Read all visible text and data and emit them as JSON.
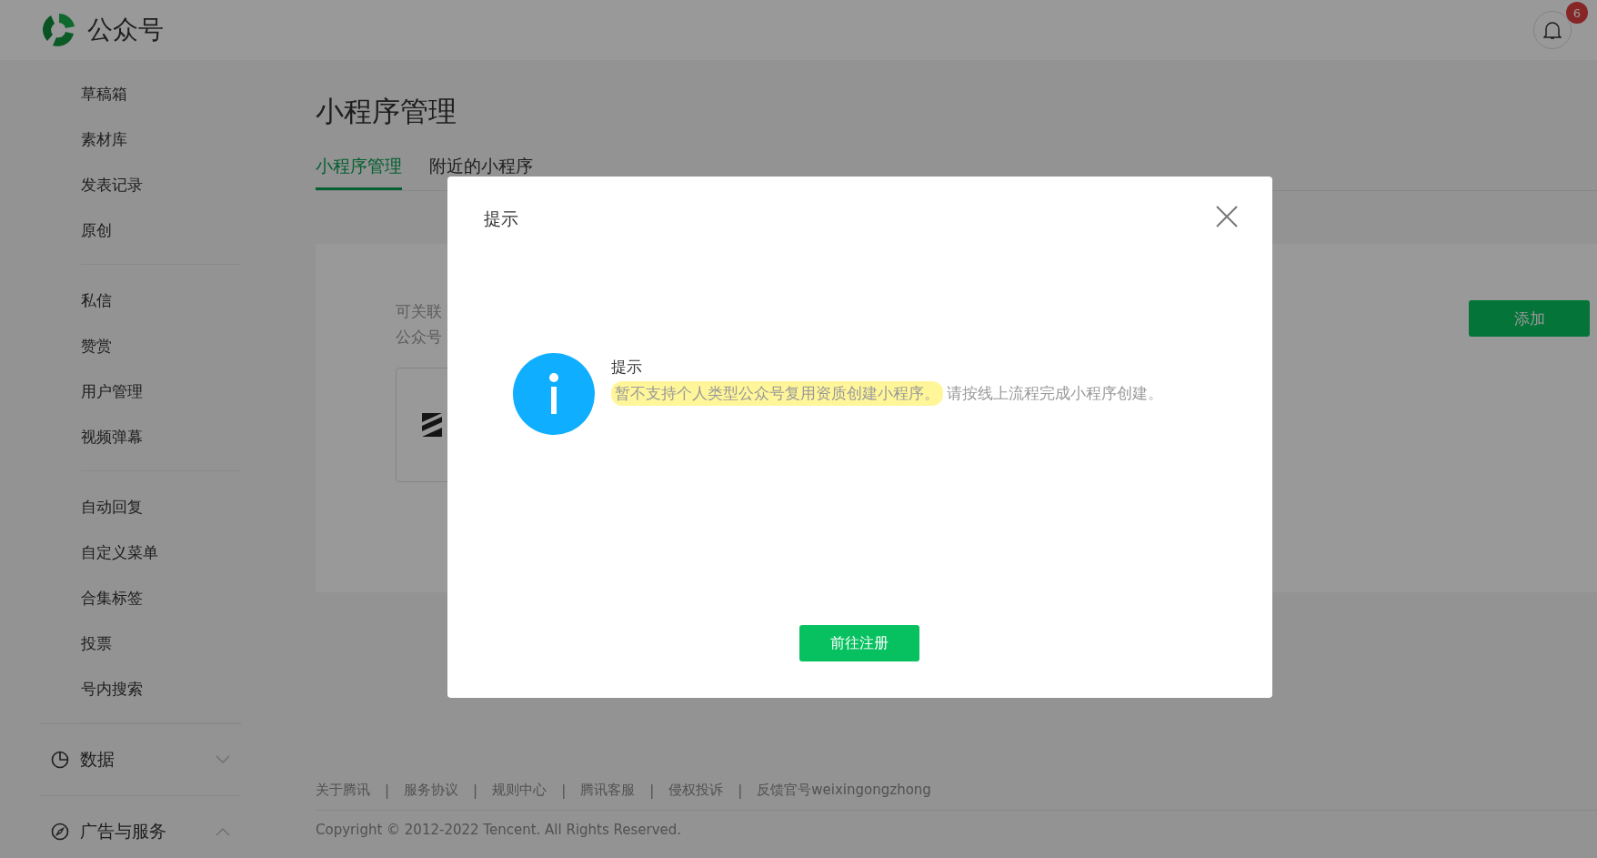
{
  "header": {
    "brand": "公众号",
    "notifications": "6"
  },
  "sidebar": {
    "groups": [
      {
        "items": [
          {
            "label": "草稿箱"
          },
          {
            "label": "素材库"
          },
          {
            "label": "发表记录"
          },
          {
            "label": "原创"
          }
        ]
      },
      {
        "items": [
          {
            "label": "私信"
          },
          {
            "label": "赞赏"
          },
          {
            "label": "用户管理"
          },
          {
            "label": "视频弹幕"
          }
        ]
      },
      {
        "items": [
          {
            "label": "自动回复"
          },
          {
            "label": "自定义菜单"
          },
          {
            "label": "合集标签"
          },
          {
            "label": "投票"
          },
          {
            "label": "号内搜索"
          }
        ]
      }
    ],
    "sections": [
      {
        "label": "数据",
        "kind": "chart",
        "expanded": false
      },
      {
        "label": "广告与服务",
        "kind": "compass",
        "expanded": true
      }
    ]
  },
  "page": {
    "title": "小程序管理",
    "tabs": [
      {
        "label": "小程序管理",
        "selected": true
      },
      {
        "label": "附近的小程序",
        "selected": false
      }
    ],
    "card": {
      "lines": [
        "可关联",
        "公众号"
      ],
      "add_button": "添加"
    }
  },
  "footer": {
    "links": [
      "关于腾讯",
      "服务协议",
      "规则中心",
      "腾讯客服",
      "侵权投诉",
      "反馈官号weixingongzhong"
    ],
    "separator": "|",
    "copyright": "Copyright © 2012-2022 Tencent. All Rights Reserved."
  },
  "dialog": {
    "title": "提示",
    "heading": "提示",
    "highlighted": "暂不支持个人类型公众号复用资质创建小程序。",
    "rest": "请按线上流程完成小程序创建。",
    "button": "前往注册"
  }
}
